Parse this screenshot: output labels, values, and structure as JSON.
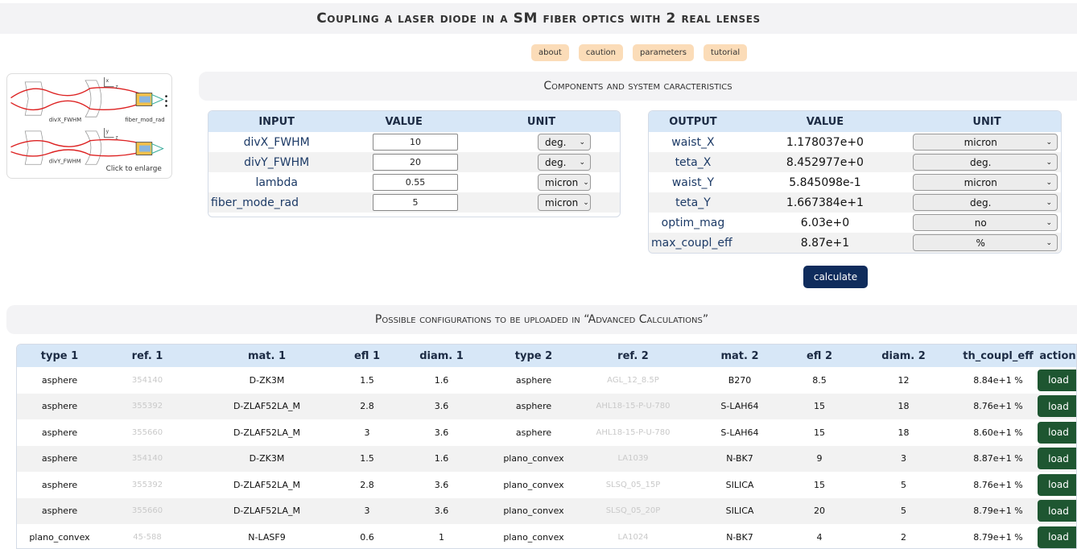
{
  "title": "Coupling a laser diode in a SM fiber optics with 2 real lenses",
  "top_buttons": [
    "about",
    "caution",
    "parameters",
    "tutorial"
  ],
  "thumbnail": {
    "click_text": "Click to enlarge",
    "label_divx": "divX_FWHM",
    "label_divy": "divY_FWHM",
    "label_fiber": "fiber_mod_rad"
  },
  "components_header": "Components and system caracteristics",
  "input_table": {
    "headers": [
      "INPUT",
      "VALUE",
      "UNIT"
    ],
    "rows": [
      {
        "name": "divX_FWHM",
        "value": "10",
        "unit": "deg."
      },
      {
        "name": "divY_FWHM",
        "value": "20",
        "unit": "deg."
      },
      {
        "name": "lambda",
        "value": "0.55",
        "unit": "micron"
      },
      {
        "name": "fiber_mode_rad",
        "value": "5",
        "unit": "micron"
      }
    ]
  },
  "output_table": {
    "headers": [
      "OUTPUT",
      "VALUE",
      "UNIT"
    ],
    "rows": [
      {
        "name": "waist_X",
        "value": "1.178037e+0",
        "unit": "micron"
      },
      {
        "name": "teta_X",
        "value": "8.452977e+0",
        "unit": "deg."
      },
      {
        "name": "waist_Y",
        "value": "5.845098e-1",
        "unit": "micron"
      },
      {
        "name": "teta_Y",
        "value": "1.667384e+1",
        "unit": "deg."
      },
      {
        "name": "optim_mag",
        "value": "6.03e+0",
        "unit": "no"
      },
      {
        "name": "max_coupl_eff",
        "value": "8.87e+1",
        "unit": "%"
      }
    ]
  },
  "calculate_label": "calculate",
  "configs_header": "Possible configurations to be uploaded in “Advanced Calculations”",
  "config_table": {
    "headers": [
      "type 1",
      "ref. 1",
      "mat. 1",
      "efl 1",
      "diam. 1",
      "type 2",
      "ref. 2",
      "mat. 2",
      "efl 2",
      "diam. 2",
      "th_coupl_eff",
      "action"
    ],
    "load_label": "load",
    "rows": [
      [
        "asphere",
        "354140",
        "D-ZK3M",
        "1.5",
        "1.6",
        "asphere",
        "AGL_12_8.5P",
        "B270",
        "8.5",
        "12",
        "8.84e+1 %"
      ],
      [
        "asphere",
        "355392",
        "D-ZLAF52LA_M",
        "2.8",
        "3.6",
        "asphere",
        "AHL18-15-P-U-780",
        "S-LAH64",
        "15",
        "18",
        "8.76e+1 %"
      ],
      [
        "asphere",
        "355660",
        "D-ZLAF52LA_M",
        "3",
        "3.6",
        "asphere",
        "AHL18-15-P-U-780",
        "S-LAH64",
        "15",
        "18",
        "8.60e+1 %"
      ],
      [
        "asphere",
        "354140",
        "D-ZK3M",
        "1.5",
        "1.6",
        "plano_convex",
        "LA1039",
        "N-BK7",
        "9",
        "3",
        "8.87e+1 %"
      ],
      [
        "asphere",
        "355392",
        "D-ZLAF52LA_M",
        "2.8",
        "3.6",
        "plano_convex",
        "SLSQ_05_15P",
        "SILICA",
        "15",
        "5",
        "8.76e+1 %"
      ],
      [
        "asphere",
        "355660",
        "D-ZLAF52LA_M",
        "3",
        "3.6",
        "plano_convex",
        "SLSQ_05_20P",
        "SILICA",
        "20",
        "5",
        "8.79e+1 %"
      ],
      [
        "plano_convex",
        "45-588",
        "N-LASF9",
        "0.6",
        "1",
        "plano_convex",
        "LA1024",
        "N-BK7",
        "4",
        "2",
        "8.79e+1 %"
      ]
    ]
  }
}
